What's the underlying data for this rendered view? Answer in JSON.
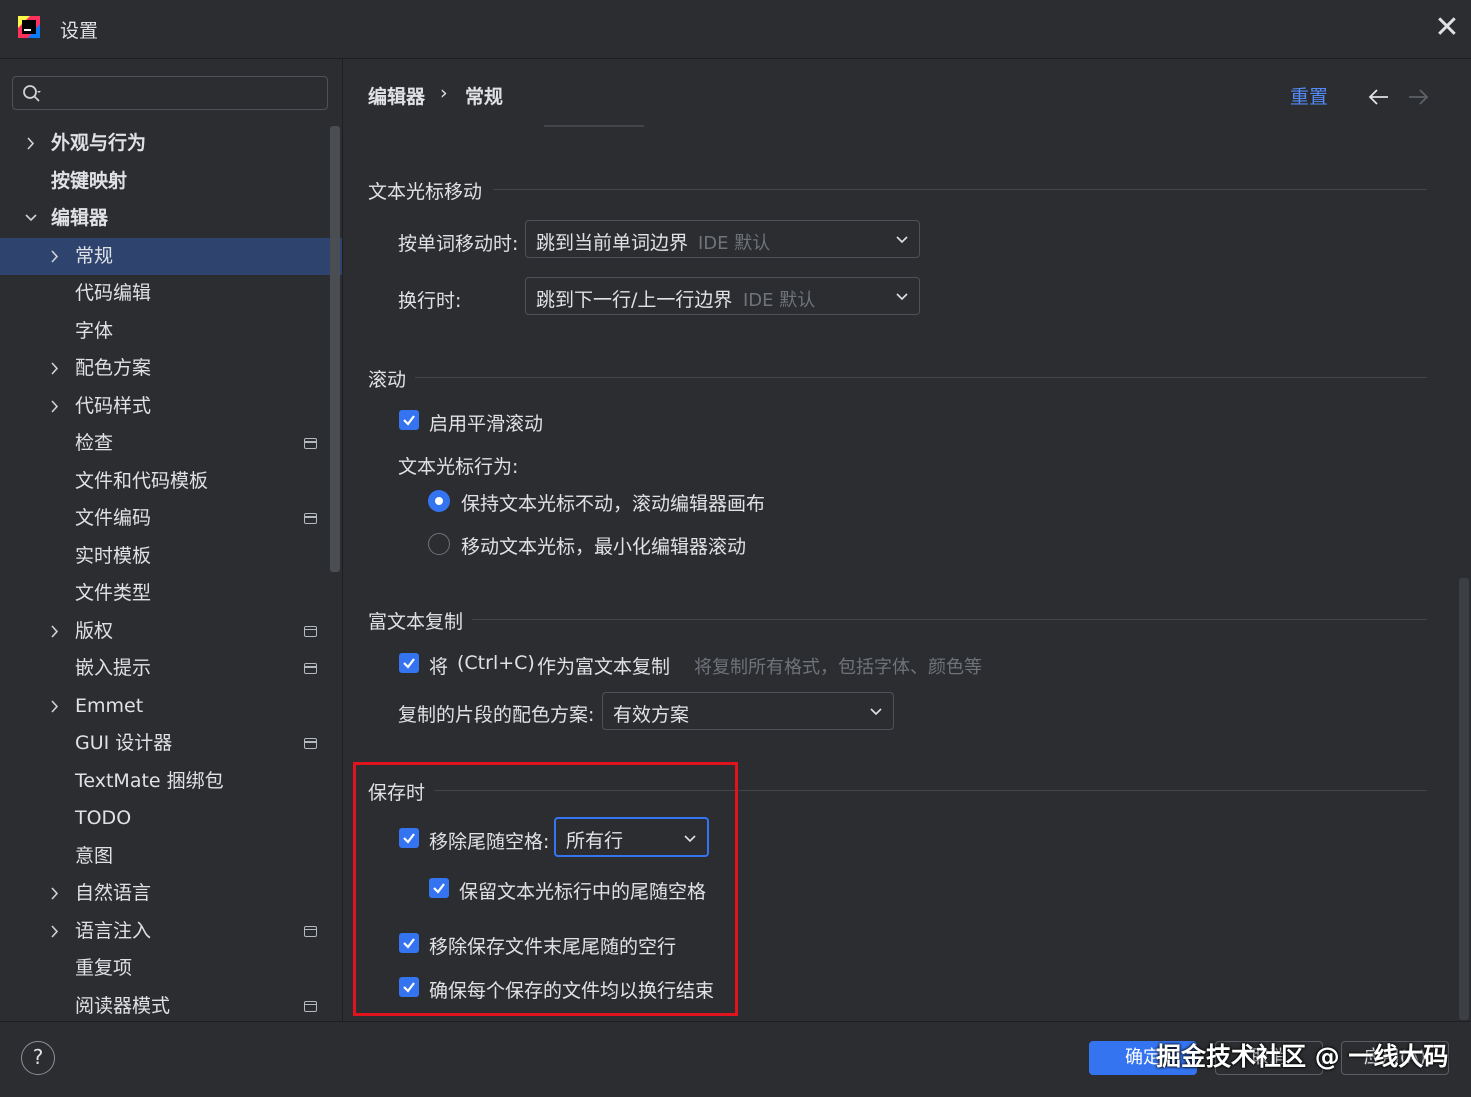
{
  "window": {
    "title": "设置",
    "close_glyph": "✕"
  },
  "search": {
    "placeholder": "",
    "value": ""
  },
  "tree": {
    "items": [
      {
        "label": "外观与行为",
        "expanded": false,
        "has_arrow": true,
        "bold": true
      },
      {
        "label": "按键映射",
        "has_arrow": false,
        "bold": true
      },
      {
        "label": "编辑器",
        "expanded": true,
        "has_arrow": true,
        "bold": true
      },
      {
        "label": "常规",
        "has_arrow": true,
        "selected": true
      },
      {
        "label": "代码编辑",
        "has_arrow": false
      },
      {
        "label": "字体",
        "has_arrow": false
      },
      {
        "label": "配色方案",
        "has_arrow": true
      },
      {
        "label": "代码样式",
        "has_arrow": true
      },
      {
        "label": "检查",
        "has_arrow": false,
        "badge": true
      },
      {
        "label": "文件和代码模板",
        "has_arrow": false
      },
      {
        "label": "文件编码",
        "has_arrow": false,
        "badge": true
      },
      {
        "label": "实时模板",
        "has_arrow": false
      },
      {
        "label": "文件类型",
        "has_arrow": false
      },
      {
        "label": "版权",
        "has_arrow": true,
        "badge": true
      },
      {
        "label": "嵌入提示",
        "has_arrow": false,
        "badge": true
      },
      {
        "label": "Emmet",
        "has_arrow": true
      },
      {
        "label": "GUI 设计器",
        "has_arrow": false,
        "badge": true
      },
      {
        "label": "TextMate 捆绑包",
        "has_arrow": false
      },
      {
        "label": "TODO",
        "has_arrow": false
      },
      {
        "label": "意图",
        "has_arrow": false
      },
      {
        "label": "自然语言",
        "has_arrow": true
      },
      {
        "label": "语言注入",
        "has_arrow": true,
        "badge": true
      },
      {
        "label": "重复项",
        "has_arrow": false
      },
      {
        "label": "阅读器模式",
        "has_arrow": false,
        "badge": true
      }
    ]
  },
  "header": {
    "breadcrumb": [
      "编辑器",
      "常规"
    ],
    "breadcrumb_sep": "›",
    "reset_label": "重置"
  },
  "caret_movement": {
    "title": "文本光标移动",
    "word_move_label": "按单词移动时:",
    "word_move_value": "跳到当前单词边界",
    "word_move_hint": "IDE 默认",
    "line_break_label": "换行时:",
    "line_break_value": "跳到下一行/上一行边界",
    "line_break_hint": "IDE 默认"
  },
  "scrolling": {
    "title": "滚动",
    "smooth_label": "启用平滑滚动",
    "smooth_checked": true,
    "caret_behavior_label": "文本光标行为:",
    "radio_keep": "保持文本光标不动，滚动编辑器画布",
    "radio_move": "移动文本光标，最小化编辑器滚动",
    "selected_radio": "keep"
  },
  "rich_copy": {
    "title": "富文本复制",
    "copy_label_prefix": "将",
    "copy_label_shortcut": "(Ctrl+C)",
    "copy_label_suffix": "作为富文本复制",
    "copy_checked": true,
    "copy_hint": "将复制所有格式，包括字体、颜色等",
    "scheme_label": "复制的片段的配色方案:",
    "scheme_value": "有效方案"
  },
  "on_save": {
    "title": "保存时",
    "strip_trailing_label": "移除尾随空格:",
    "strip_trailing_value": "所有行",
    "keep_caret_label": "保留文本光标行中的尾随空格",
    "remove_blank_lines_label": "移除保存文件末尾尾随的空行",
    "ensure_newline_label": "确保每个保存的文件均以换行结束"
  },
  "footer": {
    "help": "?",
    "ok": "确定",
    "cancel": "取消",
    "apply": "应用(A)",
    "watermark": "掘金技术社区 @ 一线大码"
  },
  "colors": {
    "background": "#2b2d30",
    "accent": "#3574f0",
    "selection": "#2e436e",
    "highlight_box": "#e0141e",
    "link": "#548af7"
  }
}
